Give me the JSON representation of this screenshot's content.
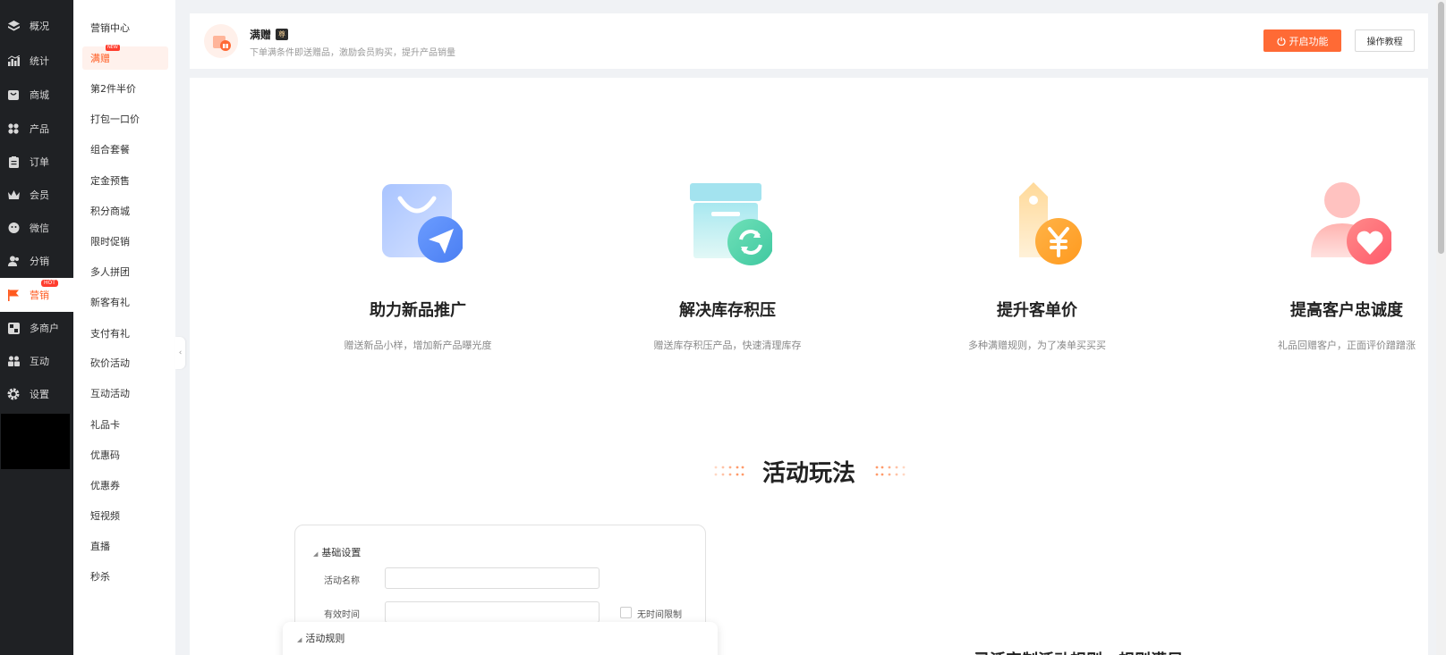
{
  "nav_primary": [
    {
      "label": "概况",
      "icon": "layers-icon"
    },
    {
      "label": "统计",
      "icon": "bar-chart-icon"
    },
    {
      "label": "商城",
      "icon": "shop-icon"
    },
    {
      "label": "产品",
      "icon": "grid-icon"
    },
    {
      "label": "订单",
      "icon": "clipboard-icon"
    },
    {
      "label": "会员",
      "icon": "crown-icon"
    },
    {
      "label": "微信",
      "icon": "chat-icon"
    },
    {
      "label": "分销",
      "icon": "users-icon"
    },
    {
      "label": "营销",
      "icon": "flag-icon",
      "badge": "HOT"
    },
    {
      "label": "多商户",
      "icon": "store-icon"
    },
    {
      "label": "互动",
      "icon": "interact-icon"
    },
    {
      "label": "设置",
      "icon": "gear-icon"
    }
  ],
  "nav_secondary": [
    {
      "label": "营销中心"
    },
    {
      "label": "满赠",
      "badge": "NEW"
    },
    {
      "label": "第2件半价"
    },
    {
      "label": "打包一口价"
    },
    {
      "label": "组合套餐"
    },
    {
      "label": "定金预售"
    },
    {
      "label": "积分商城"
    },
    {
      "label": "限时促销"
    },
    {
      "label": "多人拼团"
    },
    {
      "label": "新客有礼"
    },
    {
      "label": "支付有礼"
    },
    {
      "label": "砍价活动"
    },
    {
      "label": "互动活动"
    },
    {
      "label": "礼品卡"
    },
    {
      "label": "优惠码"
    },
    {
      "label": "优惠券"
    },
    {
      "label": "短视频"
    },
    {
      "label": "直播"
    },
    {
      "label": "秒杀"
    }
  ],
  "header": {
    "title": "满赠",
    "vip_tag": "尊",
    "description": "下单满条件即送赠品，激励会员购买，提升产品销量",
    "open_button": "开启功能",
    "tutorial_button": "操作教程"
  },
  "features": [
    {
      "title": "助力新品推广",
      "desc": "赠送新品小样，增加新产品曝光度",
      "icon": "shopping-bag-send-icon"
    },
    {
      "title": "解决库存积压",
      "desc": "赠送库存积压产品，快速清理库存",
      "icon": "inventory-refresh-icon"
    },
    {
      "title": "提升客单价",
      "desc": "多种满赠规则，为了凑单买买买",
      "icon": "price-tag-yen-icon"
    },
    {
      "title": "提高客户忠诚度",
      "desc": "礼品回赠客户，正面评价蹭蹭涨",
      "icon": "customer-heart-icon"
    }
  ],
  "section_title": "活动玩法",
  "mock_form": {
    "section_basic": "基础设置",
    "label_name": "活动名称",
    "label_time": "有效时间",
    "no_time_limit": "无时间限制",
    "section_rules": "活动规则"
  },
  "partial_text": "灵活定制活动规则，规则满足",
  "colors": {
    "accent": "#ff6a35",
    "sidebar_bg": "#1f2124",
    "active_text": "#ff5a1f"
  }
}
